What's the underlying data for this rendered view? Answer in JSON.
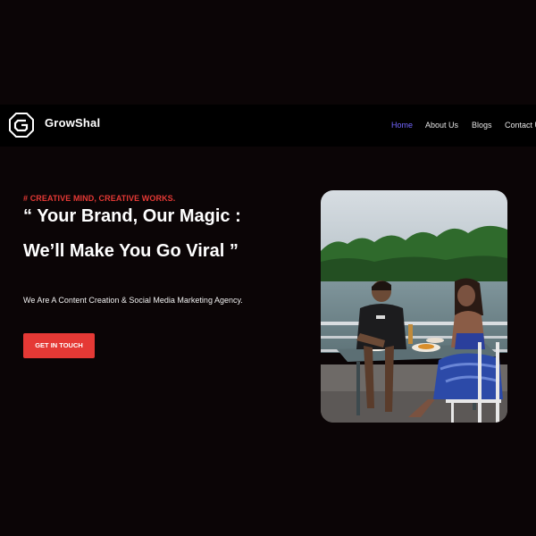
{
  "nav": {
    "brand": "GrowShal",
    "links": [
      {
        "label": "Home",
        "active": true
      },
      {
        "label": "About Us",
        "active": false
      },
      {
        "label": "Blogs",
        "active": false
      },
      {
        "label": "Contact U",
        "active": false
      }
    ]
  },
  "hero": {
    "tagline": "# CREATIVE MIND, CREATIVE WORKS.",
    "headline_line1": "“ Your Brand, Our Magic :",
    "headline_line2": "We’ll Make You Go Viral ”",
    "subtitle": "We Are A Content Creation & Social Media Marketing Agency.",
    "cta_label": "GET IN TOUCH"
  },
  "colors": {
    "background": "#0b0506",
    "navbar": "#000000",
    "accent_red": "#e53935",
    "active_link": "#7366ff"
  },
  "icons": {
    "logo": "hexagon-g-logo-icon"
  }
}
